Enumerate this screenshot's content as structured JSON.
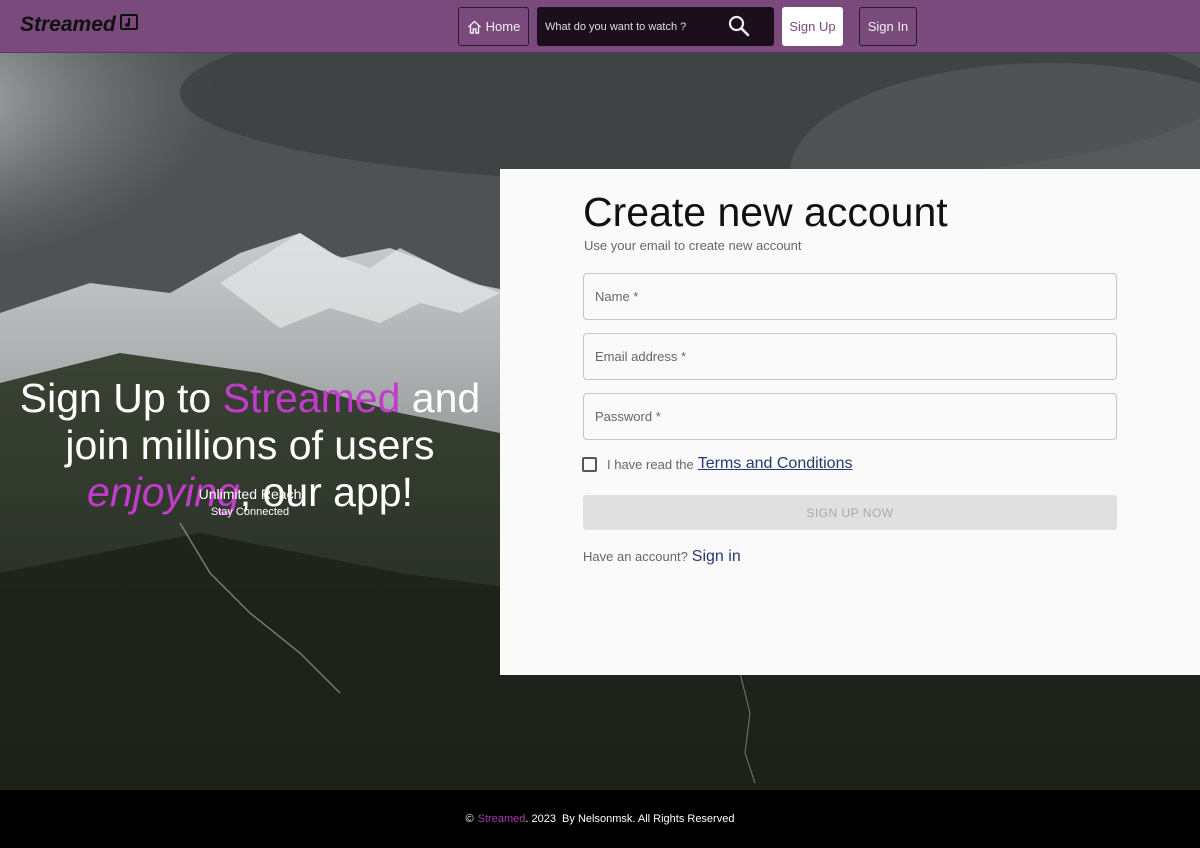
{
  "header": {
    "logo": "Streamed",
    "home_label": "Home",
    "search_placeholder": "What do you want to watch ?",
    "signup_label": "Sign Up",
    "signin_label": "Sign In"
  },
  "hero": {
    "tagline_pre": "Sign Up to ",
    "tagline_brand": "Streamed",
    "tagline_mid": " and join millions of users ",
    "tagline_em": "enjoying",
    "tagline_post": ", our app!",
    "sub1": "Unlimited Reach",
    "sub2": "Stay Connected"
  },
  "form": {
    "title": "Create new account",
    "subtitle": "Use your email to create new account",
    "name_placeholder": "Name *",
    "email_placeholder": "Email address *",
    "password_placeholder": "Password *",
    "terms_prefix": "I have read the",
    "terms_link": "Terms and Conditions",
    "submit_label": "SIGN UP NOW",
    "have_account": "Have an account?",
    "signin_link": "Sign in"
  },
  "footer": {
    "copyright": "©",
    "brand": "Streamed",
    "year": ". 2023  By Nelsonmsk. All Rights Reserved"
  },
  "colors": {
    "header_bg": "#7b4a7c",
    "accent": "#c23ccc",
    "link": "#283a6a",
    "footer_bg": "#000000"
  },
  "icons": [
    "music-note-icon",
    "home-icon",
    "search-icon",
    "checkbox-icon"
  ]
}
